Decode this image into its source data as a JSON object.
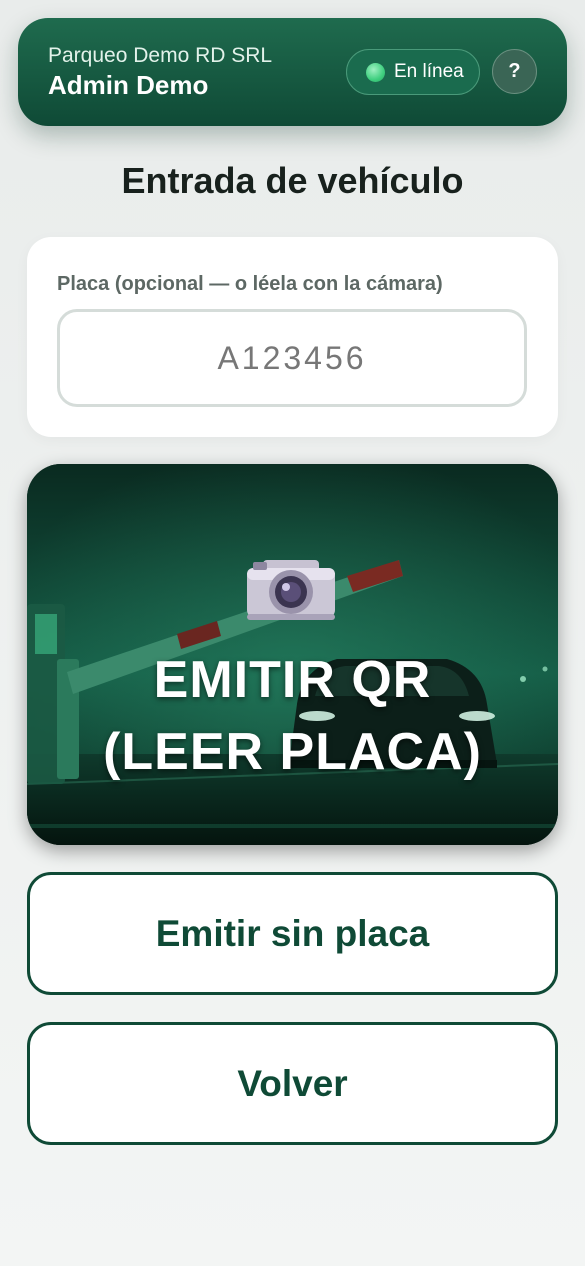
{
  "header": {
    "org_name": "Parqueo Demo RD SRL",
    "user_name": "Admin Demo",
    "status_label": "En línea",
    "status_color": "#3fcf7f",
    "help_label": "?"
  },
  "page_title": "Entrada de vehículo",
  "plate": {
    "label": "Placa (opcional — o léela con la cámara)",
    "placeholder": "A123456",
    "value": ""
  },
  "camera_button": {
    "icon": "camera-icon",
    "line1": "EMITIR QR",
    "line2": "(LEER PLACA)"
  },
  "no_plate_button": {
    "label": "Emitir sin placa"
  },
  "back_button": {
    "label": "Volver"
  },
  "colors": {
    "brand": "#0f4a36",
    "brand_light": "#1f6b4e",
    "background": "#f1f3f2"
  }
}
